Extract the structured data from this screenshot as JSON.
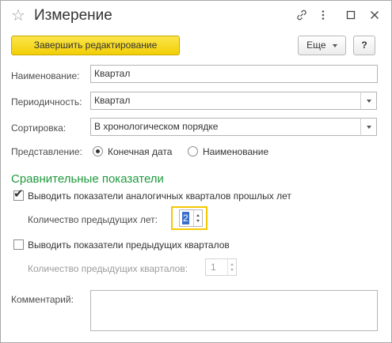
{
  "window": {
    "title": "Измерение",
    "icons": [
      "star-icon",
      "link-icon",
      "more-vertical-icon",
      "maximize-icon",
      "close-icon"
    ]
  },
  "toolbar": {
    "finish_label": "Завершить редактирование",
    "more_label": "Еще",
    "help_label": "?"
  },
  "form": {
    "name_label": "Наименование:",
    "name_value": "Квартал",
    "period_label": "Периодичность:",
    "period_value": "Квартал",
    "sort_label": "Сортировка:",
    "sort_value": "В хронологическом порядке",
    "repr_label": "Представление:",
    "repr_options": [
      {
        "label": "Конечная дата",
        "selected": true
      },
      {
        "label": "Наименование",
        "selected": false
      }
    ],
    "section_title": "Сравнительные показатели",
    "show_same_quarters_label": "Выводить показатели аналогичных кварталов прошлых лет",
    "show_same_quarters_checked": true,
    "prev_years_count_label": "Количество предыдущих лет:",
    "prev_years_count_value": "2",
    "show_prev_quarters_label": "Выводить показатели предыдущих кварталов",
    "show_prev_quarters_checked": false,
    "prev_quarters_count_label": "Количество предыдущих кварталов:",
    "prev_quarters_count_value": "1",
    "comment_label": "Комментарий:",
    "comment_value": ""
  },
  "colors": {
    "primary_button": "#f4d312",
    "section_title": "#1e9a3c",
    "focus": "#f5c800"
  }
}
